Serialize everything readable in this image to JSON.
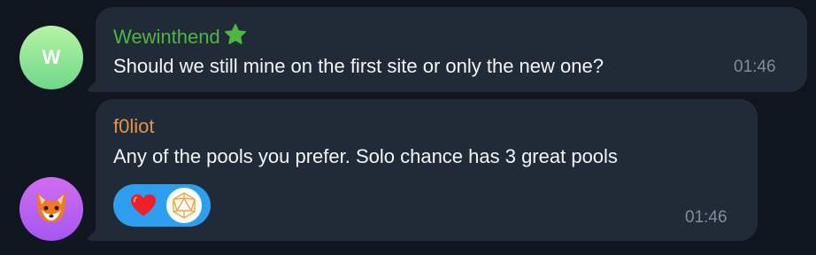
{
  "messages": [
    {
      "sender": "Wewinthend",
      "avatar_initial": "W",
      "text": "Should we still mine on the first site or only the new one?",
      "time": "01:46",
      "sender_badge": "star-icon"
    },
    {
      "sender": "f0liot",
      "avatar_emoji": "🦊",
      "text": "Any of the pools you prefer. Solo chance has 3 great pools",
      "time": "01:46",
      "reaction": {
        "emoji": "heart-icon",
        "reactor_avatar": "polyhedron-icon"
      }
    }
  ],
  "colors": {
    "background": "#0f1620",
    "bubble": "#212b38",
    "sender_1": "#4fb543",
    "sender_2": "#e3924a",
    "reaction_pill": "#2e9ef1"
  }
}
